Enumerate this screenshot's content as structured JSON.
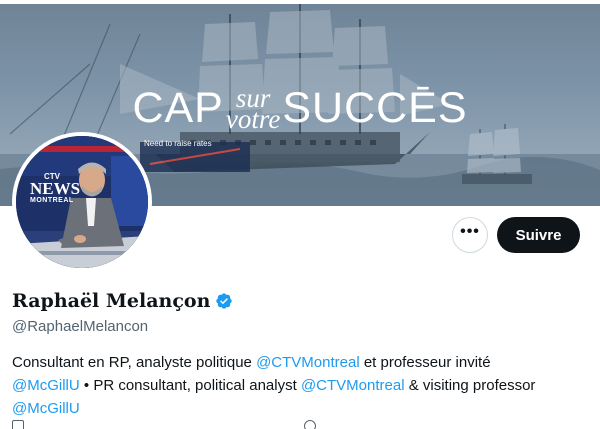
{
  "banner": {
    "title_left": "CAP",
    "title_mid_top": "sur",
    "title_mid_bottom": "votre",
    "title_right": "SUCCĒS",
    "screen_caption": "Need to raise rates"
  },
  "avatar": {
    "logo_top": "CTV",
    "logo_main": "NEWS",
    "logo_sub": "MONTREAL"
  },
  "actions": {
    "more_label": "•••",
    "follow_label": "Suivre"
  },
  "profile": {
    "display_name": "Raphaël Melançon",
    "handle": "@RaphaelMelancon"
  },
  "bio": {
    "segments": [
      "Consultant en RP, analyste politique ",
      "@CTVMontreal",
      " et professeur invité ",
      "@McGillU",
      " • PR consultant, political analyst ",
      "@CTVMontreal",
      " & visiting professor ",
      "@McGillU"
    ]
  },
  "colors": {
    "link": "#1d9bf0",
    "verified": "#1d9bf0",
    "follow_bg": "#0f1419",
    "muted": "#536471"
  },
  "icons": {
    "verified": "verified-badge-icon",
    "more": "more-options-icon"
  }
}
